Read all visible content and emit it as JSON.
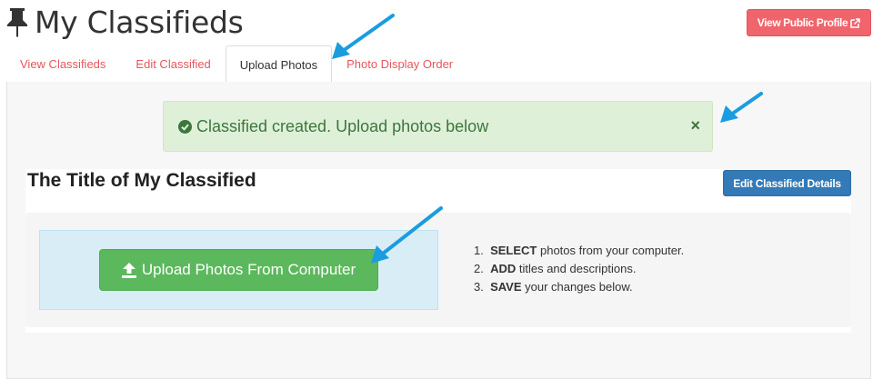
{
  "header": {
    "title": "My Classifieds",
    "profile_button": "View Public Profile"
  },
  "tabs": [
    {
      "label": "View Classifieds",
      "active": false
    },
    {
      "label": "Edit Classified",
      "active": false
    },
    {
      "label": "Upload Photos",
      "active": true
    },
    {
      "label": "Photo Display Order",
      "active": false
    }
  ],
  "alert": {
    "message": "Classified created. Upload photos below",
    "close": "×"
  },
  "classified": {
    "title": "The Title of My Classified",
    "edit_button": "Edit Classified Details"
  },
  "upload": {
    "button_label": "Upload Photos From Computer",
    "steps": [
      {
        "num": "1.",
        "bold": "SELECT",
        "rest": " photos from your computer."
      },
      {
        "num": "2.",
        "bold": "ADD",
        "rest": " titles and descriptions."
      },
      {
        "num": "3.",
        "bold": "SAVE",
        "rest": " your changes below."
      }
    ]
  },
  "colors": {
    "accent_red": "#f0646b",
    "tab_link": "#e8555c",
    "alert_bg": "#dff0d8",
    "alert_text": "#3c763d",
    "primary_blue": "#337ab7",
    "success_green": "#5cb85c",
    "dropzone_bg": "#d9edf7",
    "annotation_arrow": "#1a9de0"
  }
}
